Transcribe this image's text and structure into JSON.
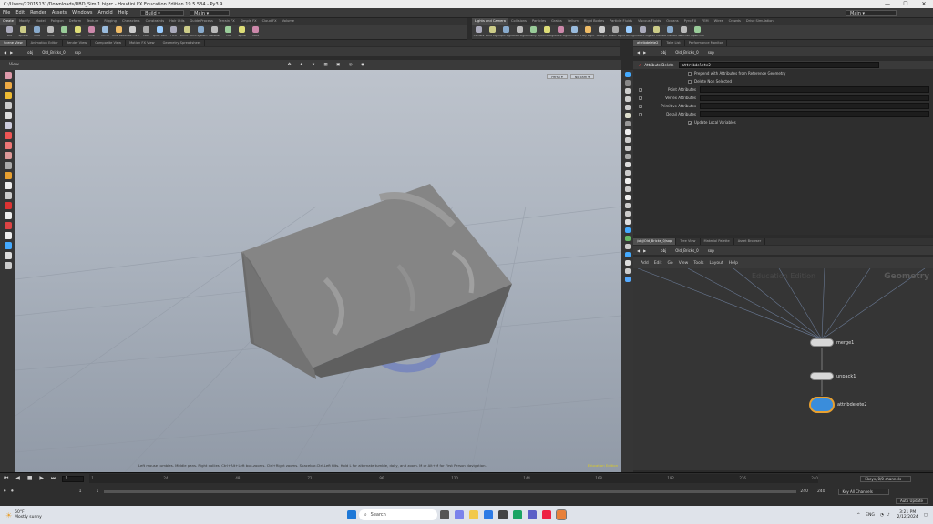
{
  "window": {
    "title": "C:/Users/22015131/Downloads/RBD_Sim 1.hiprc - Houdini FX Education Edition 19.5.534 - Py3.9",
    "min": "—",
    "max": "☐",
    "close": "✕"
  },
  "menu": {
    "items": [
      "File",
      "Edit",
      "Render",
      "Assets",
      "Windows",
      "Arnold",
      "Help"
    ],
    "desktop": "Build",
    "context": "Main",
    "right_context": "Main"
  },
  "shelf_tabs_left": [
    "Create",
    "Modify",
    "Model",
    "Polygon",
    "Deform",
    "Texture",
    "Rigging",
    "Characters",
    "Constraints",
    "Hair Utils",
    "Guide Process",
    "Terrain FX",
    "Simple FX",
    "Cloud FX",
    "Volume"
  ],
  "shelf_tabs_right": [
    "Lights and Camera",
    "Collisions",
    "Particles",
    "Grains",
    "Vellum",
    "Rigid Bodies",
    "Particle Fluids",
    "Viscous Fluids",
    "Oceans",
    "Pyro FX",
    "FEM",
    "Wires",
    "Crowds",
    "Drive Simulation"
  ],
  "shelf_tools_left": [
    "Box",
    "Sphere",
    "Tube",
    "Torus",
    "Grid",
    "Null",
    "Line",
    "Circle",
    "Curve Bezier",
    "Draw Curve",
    "Path",
    "Spray Paint",
    "Font",
    "Platonic Solids",
    "L-System",
    "Metaball",
    "File",
    "Spiral",
    "Helix"
  ],
  "shelf_tools_right": [
    "Camera",
    "Point Light",
    "Spot Light",
    "Area Light",
    "Geometry Light",
    "Volume Light",
    "Distant Light",
    "Environment Light",
    "Sky Light",
    "GI Light",
    "Caustic Light",
    "Portal Light",
    "Ambient Light",
    "Stereo Camera",
    "VR Camera",
    "Switcher",
    "Gamepad Camera"
  ],
  "left_panel_tabs": [
    "Scene View",
    "Animation Editor",
    "Render View",
    "Composite View",
    "Motion FX View",
    "Geometry Spreadsheet"
  ],
  "right_top_tabs": [
    "attribdelete2",
    "Take List",
    "Performance Monitor"
  ],
  "right_bottom_tabs": [
    "/obj/Old_Bricks_0/sop",
    "Tree View",
    "Material Palette",
    "Asset Browser"
  ],
  "path": {
    "obj": "obj",
    "object": "Old_Bricks_0",
    "sop": "sop"
  },
  "viewport": {
    "label": "View",
    "persp": "Persp ▾",
    "cam": "No cam ▾",
    "status": "Left mouse tumbles. Middle pans. Right dollies. Ctrl+Alt+Left box-zooms. Ctrl+Right zooms. Spacebar-Ctrl-Left tilts. Hold L for alternate tumble, dolly, and zoom.    M or Alt+M for First Person Navigation.",
    "edition": "Education Edition"
  },
  "params": {
    "node_type": "Attribute Delete",
    "node_name": "attribdelete2",
    "opt1": "Prepend with Attributes from Reference Geometry",
    "opt2": "Delete Non Selected",
    "fields": [
      "Point Attributes",
      "Vertex Attributes",
      "Primitive Attributes",
      "Detail Attributes"
    ],
    "opt3": "Update Local Variables"
  },
  "network": {
    "menu": [
      "Add",
      "Edit",
      "Go",
      "View",
      "Tools",
      "Layout",
      "Help"
    ],
    "watermark_left": "Education Edition",
    "watermark_right": "Geometry",
    "nodes": [
      "merge1",
      "unpack1",
      "attribdelete2"
    ]
  },
  "timeline": {
    "ticks": [
      "1",
      "24",
      "48",
      "72",
      "96",
      "120",
      "144",
      "168",
      "192",
      "216",
      "240"
    ],
    "frame": "1",
    "start": "1",
    "start2": "1",
    "end": "240",
    "end2": "240",
    "channels": "Ekeys, 0/0 channels",
    "keyall": "Key All Channels",
    "autoupdate": "Auto Update"
  },
  "taskbar": {
    "weather_temp": "50°F",
    "weather_desc": "Mostly sunny",
    "search": "Search",
    "lang": "ENG",
    "time": "3:21 PM",
    "date": "2/12/2024"
  },
  "colors": {
    "accent": "#e8a030",
    "viewport_top": "#bdc3cc",
    "viewport_bottom": "#919aa7",
    "node_blue": "#3a8ddb"
  }
}
